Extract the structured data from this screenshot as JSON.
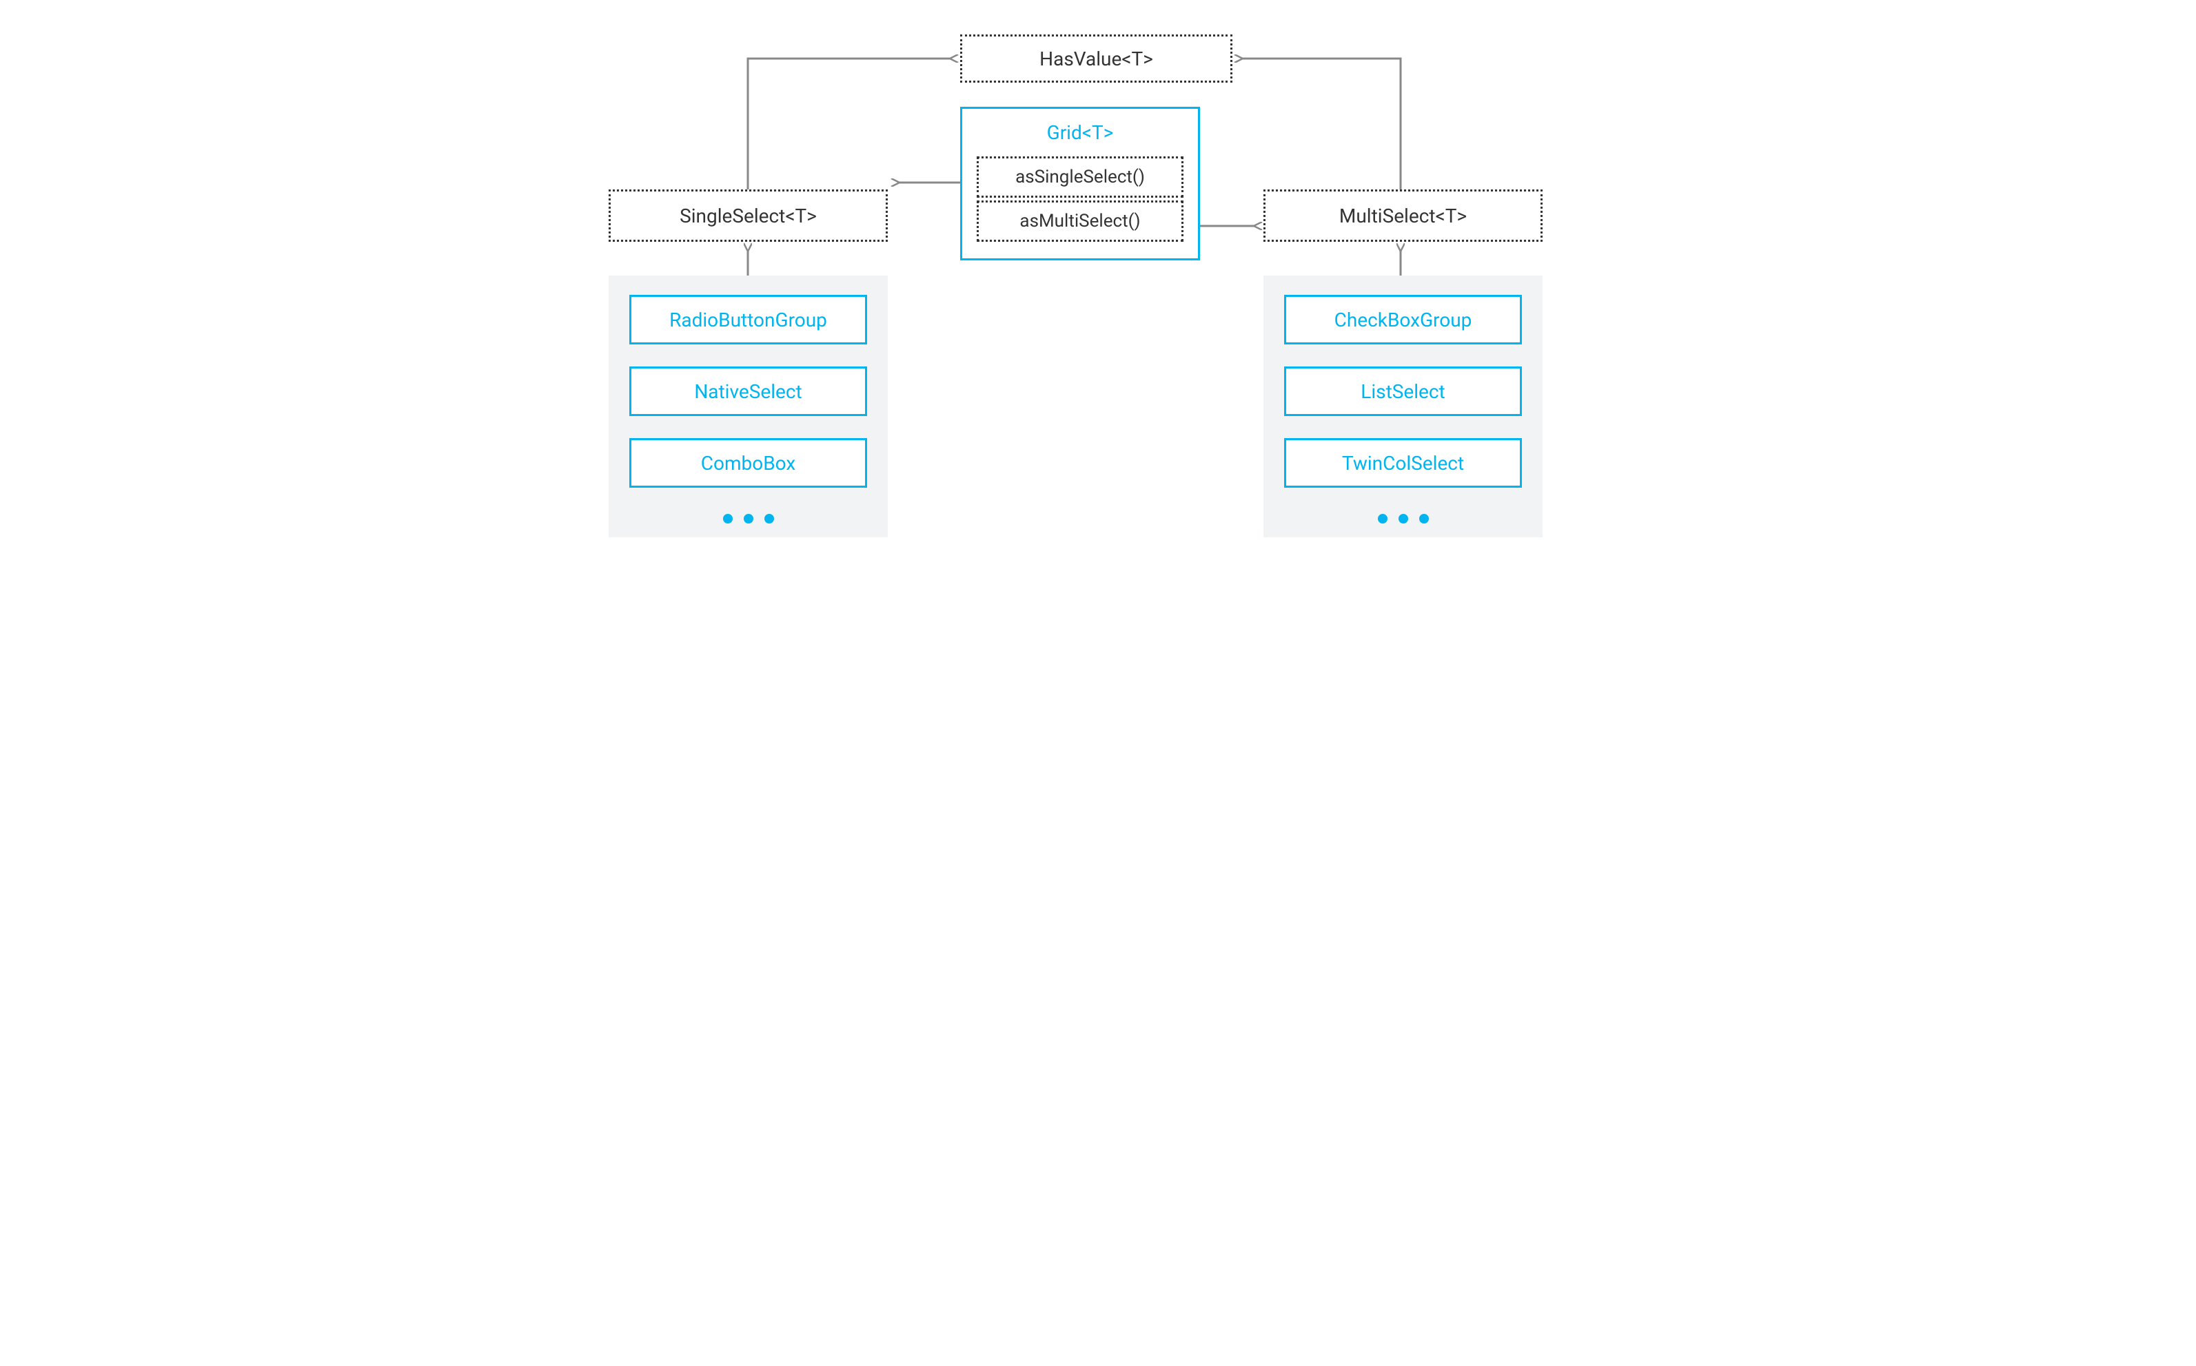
{
  "root": {
    "label": "HasValue<T>"
  },
  "left_interface": {
    "label": "SingleSelect<T>",
    "impls": [
      "RadioButtonGroup",
      "NativeSelect",
      "ComboBox"
    ]
  },
  "right_interface": {
    "label": "MultiSelect<T>",
    "impls": [
      "CheckBoxGroup",
      "ListSelect",
      "TwinColSelect"
    ]
  },
  "grid": {
    "title": "Grid<T>",
    "methods": [
      "asSingleSelect()",
      "asMultiSelect()"
    ]
  },
  "colors": {
    "accent": "#00b4f0",
    "panel": "#f2f3f4",
    "arrow": "#888"
  }
}
